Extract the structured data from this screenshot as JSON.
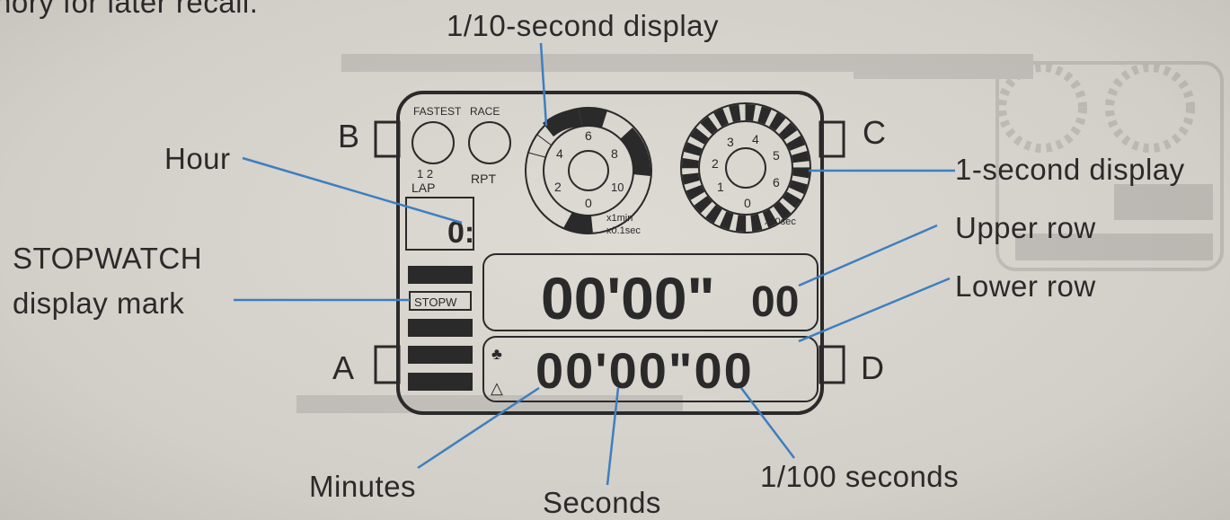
{
  "top_fragment": "nory for later recall.",
  "callouts": {
    "tenth_second_display": "1/10-second display",
    "hour": "Hour",
    "one_second_display": "1-second display",
    "upper_row": "Upper row",
    "lower_row": "Lower row",
    "stopwatch_mark_line1": "STOPWATCH",
    "stopwatch_mark_line2": "display mark",
    "minutes": "Minutes",
    "seconds": "Seconds",
    "hundredth_seconds": "1/100 seconds"
  },
  "buttons": {
    "a": "A",
    "b": "B",
    "c": "C",
    "d": "D"
  },
  "watch": {
    "fastest": "FASTEST",
    "race": "RACE",
    "lap_nums": "1  2",
    "lap": "LAP",
    "rpt": "RPT",
    "tenth_dial_nums": [
      "6",
      "4",
      "8",
      "2",
      "10",
      "0"
    ],
    "tenth_dial_scale1": "x1min",
    "tenth_dial_scale2": "x0.1sec",
    "second_dial_nums": [
      "3",
      "4",
      "2",
      "5",
      "1",
      "6",
      "0"
    ],
    "second_dial_scale": "x10sec",
    "hour_value": "0:",
    "stopw_mark": "STOPW",
    "upper_main": "00'00\"",
    "upper_small": "00",
    "lower_digits": "00'00\"00"
  },
  "colors": {
    "leader_line": "#3d7fbf",
    "ink": "#2b2a2a",
    "paper": "#d6d2cc"
  }
}
